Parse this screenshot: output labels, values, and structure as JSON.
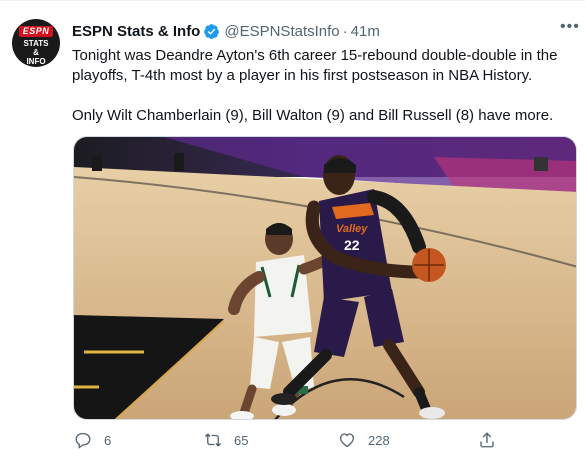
{
  "account": {
    "name": "ESPN Stats & Info",
    "handle": "@ESPNStatsInfo",
    "separator": "·",
    "time": "41m",
    "avatar_text_top": "ESPN",
    "avatar_text_mid": "STATS",
    "avatar_text_amp": "&",
    "avatar_text_bot": "INFO"
  },
  "tweet": {
    "paragraph1": "Tonight was Deandre Ayton's 6th career 15-rebound double-double in the playoffs, T-4th most by a player in his first postseason in NBA History.",
    "paragraph2": "Only Wilt Chamberlain (9), Bill Walton (9) and Bill Russell (8) have more."
  },
  "media": {
    "jersey_team": "Valley",
    "jersey_number": "22"
  },
  "actions": {
    "reply_count": "6",
    "retweet_count": "65",
    "like_count": "228"
  },
  "colors": {
    "verified": "#1d9bf0",
    "muted": "#536471",
    "court": "#d9b58a",
    "suns_purple": "#2a1a4a",
    "bucks_green": "#1b3a2a"
  }
}
